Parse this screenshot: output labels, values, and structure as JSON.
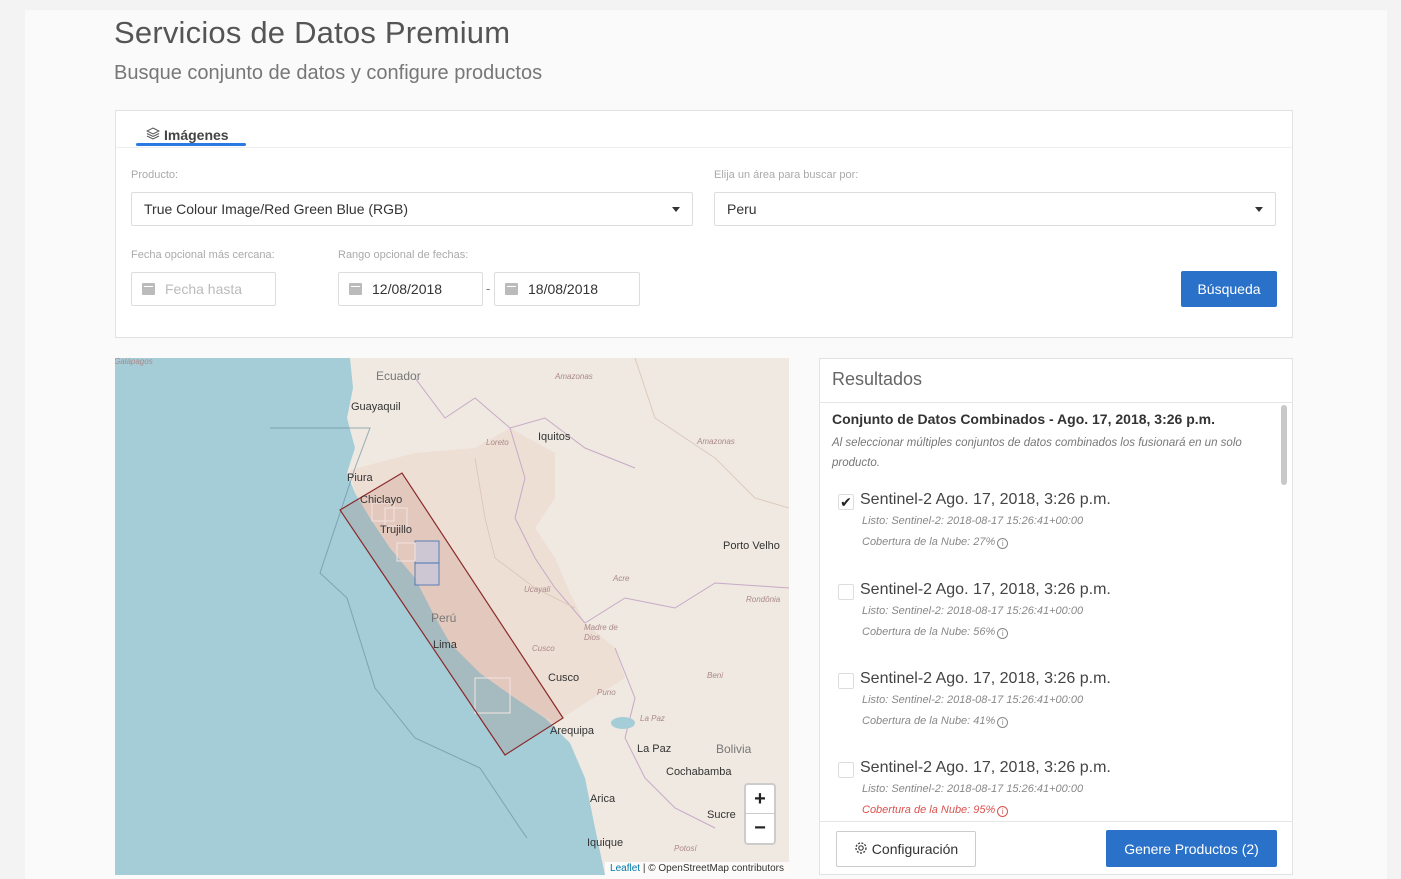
{
  "header": {
    "title": "Servicios de Datos Premium",
    "subtitle": "Busque conjunto de datos y configure productos"
  },
  "search": {
    "tab_label": "Imágenes",
    "product_label": "Producto:",
    "product_value": "True Colour Image/Red Green Blue (RGB)",
    "area_label": "Elija un área para buscar por:",
    "area_value": "Peru",
    "closest_date_label": "Fecha opcional más cercana:",
    "closest_date_placeholder": "Fecha hasta",
    "range_label": "Rango opcional de fechas:",
    "range_from": "12/08/2018",
    "range_separator": "-",
    "range_to": "18/08/2018",
    "search_button": "Búsqueda"
  },
  "map": {
    "labels": {
      "ecuador": "Ecuador",
      "guayaquil": "Guayaquil",
      "amazonas_n": "Amazonas",
      "loreto": "Loreto",
      "iquitos": "Iquitos",
      "amazonas_e": "Amazonas",
      "piura": "Piura",
      "chiclayo": "Chiclayo",
      "trujillo": "Trujillo",
      "porto_velho": "Porto Velho",
      "ucayali": "Ucayali",
      "acre": "Acre",
      "rondonia": "Rondônia",
      "peru": "Perú",
      "lima": "Lima",
      "madre_de_dios": "Madre de Dios",
      "cusco_region": "Cusco",
      "cusco": "Cusco",
      "beni": "Beni",
      "puno": "Puno",
      "la_paz_region": "La Paz",
      "arequipa": "Arequipa",
      "la_paz": "La Paz",
      "bolivia": "Bolivia",
      "cochabamba": "Cochabamba",
      "arica": "Arica",
      "sucre": "Sucre",
      "iquique": "Iquique",
      "potosi": "Potosí",
      "galapagos": "Galápagos"
    },
    "zoom_in": "+",
    "zoom_out": "−",
    "attribution_link": "Leaflet",
    "attribution_text": "| © OpenStreetMap contributors"
  },
  "results": {
    "title": "Resultados",
    "combined_title": "Conjunto de Datos Combinados - Ago. 17, 2018, 3:26 p.m.",
    "combined_note": "Al seleccionar múltiples conjuntos de datos combinados los fusionará en un solo producto.",
    "items": [
      {
        "checked": true,
        "title": "Sentinel-2 Ago. 17, 2018, 3:26 p.m.",
        "ready": "Listo: Sentinel-2: 2018-08-17 15:26:41+00:00",
        "cloud": "Cobertura de la Nube: 27%",
        "warn": false
      },
      {
        "checked": false,
        "title": "Sentinel-2 Ago. 17, 2018, 3:26 p.m.",
        "ready": "Listo: Sentinel-2: 2018-08-17 15:26:41+00:00",
        "cloud": "Cobertura de la Nube: 56%",
        "warn": false
      },
      {
        "checked": false,
        "title": "Sentinel-2 Ago. 17, 2018, 3:26 p.m.",
        "ready": "Listo: Sentinel-2: 2018-08-17 15:26:41+00:00",
        "cloud": "Cobertura de la Nube: 41%",
        "warn": false
      },
      {
        "checked": false,
        "title": "Sentinel-2 Ago. 17, 2018, 3:26 p.m.",
        "ready": "Listo: Sentinel-2: 2018-08-17 15:26:41+00:00",
        "cloud": "Cobertura de la Nube: 95%",
        "warn": true
      }
    ],
    "config_button": "Configuración",
    "generate_button": "Genere Productos (2)"
  },
  "colors": {
    "primary": "#2a72c9",
    "tab_accent": "#2a7ae2",
    "warning": "#d9534f",
    "sea": "#a4cdd8",
    "land": "#efe9e1",
    "aoi_border": "#8b2a2a"
  }
}
